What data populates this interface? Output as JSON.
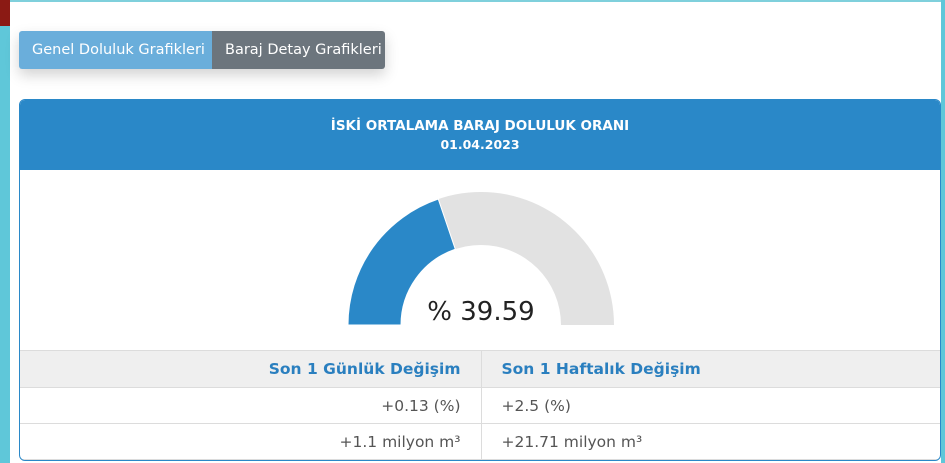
{
  "tabs": {
    "genel_label": "Genel Doluluk Grafikleri",
    "detay_label": "Baraj Detay Grafikleri"
  },
  "card": {
    "title": "İSKİ ORTALAMA BARAJ DOLULUK ORANI",
    "date": "01.04.2023"
  },
  "gauge": {
    "value_text": "% 39.59",
    "value": 39.59,
    "max": 100,
    "fill_color": "#2a88c8",
    "track_color": "#e2e2e2"
  },
  "stats": {
    "headers": [
      "Son 1 Günlük Değişim",
      "Son 1 Haftalık Değişim"
    ],
    "rows": [
      [
        "+0.13 (%)",
        "+2.5 (%)"
      ],
      [
        "+1.1 milyon m³",
        "+21.71 milyon m³"
      ]
    ]
  },
  "colors": {
    "accent": "#2a88c8",
    "tab_active": "#6aaedb",
    "tab_inactive": "#6c757d"
  }
}
